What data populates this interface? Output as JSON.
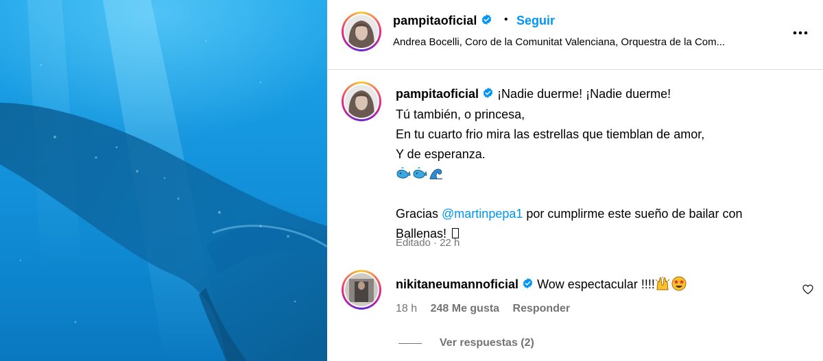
{
  "header": {
    "username": "pampitaoficial",
    "separator": "•",
    "follow_label": "Seguir",
    "audio": "Andrea Bocelli, Coro de la Comunitat Valenciana, Orquestra de la Com..."
  },
  "caption": {
    "username": "pampitaoficial",
    "lines": [
      "¡Nadie duerme! ¡Nadie duerme!",
      "Tú también, o princesa,",
      "En tu cuarto frio mira las estrellas que tiemblan de amor,",
      "Y de esperanza."
    ],
    "emojis": [
      "whale-emoji",
      "whale-emoji",
      "wave-emoji"
    ],
    "thanks_prefix": "Gracias ",
    "mention": "@martinpepa1",
    "thanks_suffix": " por cumplirme este sueño de bailar con",
    "thanks_line2": "Ballenas! ",
    "edited": "Editado · 22 h"
  },
  "comment": {
    "username": "nikitaneumannoficial",
    "text": "Wow espectacular !!!!",
    "emojis": [
      "raising-hands-emoji",
      "star-struck-emoji"
    ],
    "time": "18 h",
    "likes": "248 Me gusta",
    "reply_label": "Responder",
    "view_replies": "Ver respuestas (2)"
  },
  "colors": {
    "accent": "#0095f6",
    "muted": "#737373",
    "divider": "#dbdbdb",
    "ocean": "#1596de"
  },
  "icons": {
    "verified": "verified-badge-icon",
    "more": "more-options-icon",
    "like": "heart-icon"
  }
}
